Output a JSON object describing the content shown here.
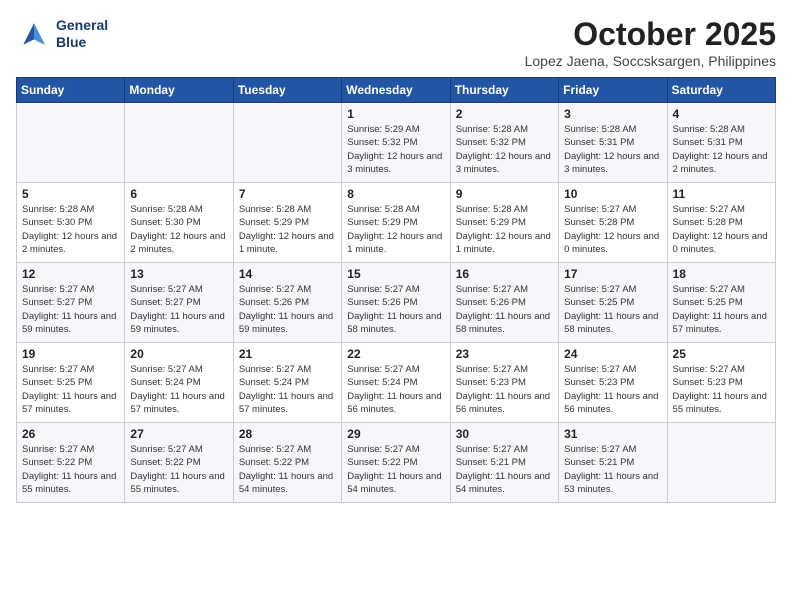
{
  "header": {
    "logo_line1": "General",
    "logo_line2": "Blue",
    "month": "October 2025",
    "location": "Lopez Jaena, Soccsksargen, Philippines"
  },
  "weekdays": [
    "Sunday",
    "Monday",
    "Tuesday",
    "Wednesday",
    "Thursday",
    "Friday",
    "Saturday"
  ],
  "weeks": [
    [
      {
        "day": "",
        "info": ""
      },
      {
        "day": "",
        "info": ""
      },
      {
        "day": "",
        "info": ""
      },
      {
        "day": "1",
        "info": "Sunrise: 5:29 AM\nSunset: 5:32 PM\nDaylight: 12 hours\nand 3 minutes."
      },
      {
        "day": "2",
        "info": "Sunrise: 5:28 AM\nSunset: 5:32 PM\nDaylight: 12 hours\nand 3 minutes."
      },
      {
        "day": "3",
        "info": "Sunrise: 5:28 AM\nSunset: 5:31 PM\nDaylight: 12 hours\nand 3 minutes."
      },
      {
        "day": "4",
        "info": "Sunrise: 5:28 AM\nSunset: 5:31 PM\nDaylight: 12 hours\nand 2 minutes."
      }
    ],
    [
      {
        "day": "5",
        "info": "Sunrise: 5:28 AM\nSunset: 5:30 PM\nDaylight: 12 hours\nand 2 minutes."
      },
      {
        "day": "6",
        "info": "Sunrise: 5:28 AM\nSunset: 5:30 PM\nDaylight: 12 hours\nand 2 minutes."
      },
      {
        "day": "7",
        "info": "Sunrise: 5:28 AM\nSunset: 5:29 PM\nDaylight: 12 hours\nand 1 minute."
      },
      {
        "day": "8",
        "info": "Sunrise: 5:28 AM\nSunset: 5:29 PM\nDaylight: 12 hours\nand 1 minute."
      },
      {
        "day": "9",
        "info": "Sunrise: 5:28 AM\nSunset: 5:29 PM\nDaylight: 12 hours\nand 1 minute."
      },
      {
        "day": "10",
        "info": "Sunrise: 5:27 AM\nSunset: 5:28 PM\nDaylight: 12 hours\nand 0 minutes."
      },
      {
        "day": "11",
        "info": "Sunrise: 5:27 AM\nSunset: 5:28 PM\nDaylight: 12 hours\nand 0 minutes."
      }
    ],
    [
      {
        "day": "12",
        "info": "Sunrise: 5:27 AM\nSunset: 5:27 PM\nDaylight: 11 hours\nand 59 minutes."
      },
      {
        "day": "13",
        "info": "Sunrise: 5:27 AM\nSunset: 5:27 PM\nDaylight: 11 hours\nand 59 minutes."
      },
      {
        "day": "14",
        "info": "Sunrise: 5:27 AM\nSunset: 5:26 PM\nDaylight: 11 hours\nand 59 minutes."
      },
      {
        "day": "15",
        "info": "Sunrise: 5:27 AM\nSunset: 5:26 PM\nDaylight: 11 hours\nand 58 minutes."
      },
      {
        "day": "16",
        "info": "Sunrise: 5:27 AM\nSunset: 5:26 PM\nDaylight: 11 hours\nand 58 minutes."
      },
      {
        "day": "17",
        "info": "Sunrise: 5:27 AM\nSunset: 5:25 PM\nDaylight: 11 hours\nand 58 minutes."
      },
      {
        "day": "18",
        "info": "Sunrise: 5:27 AM\nSunset: 5:25 PM\nDaylight: 11 hours\nand 57 minutes."
      }
    ],
    [
      {
        "day": "19",
        "info": "Sunrise: 5:27 AM\nSunset: 5:25 PM\nDaylight: 11 hours\nand 57 minutes."
      },
      {
        "day": "20",
        "info": "Sunrise: 5:27 AM\nSunset: 5:24 PM\nDaylight: 11 hours\nand 57 minutes."
      },
      {
        "day": "21",
        "info": "Sunrise: 5:27 AM\nSunset: 5:24 PM\nDaylight: 11 hours\nand 57 minutes."
      },
      {
        "day": "22",
        "info": "Sunrise: 5:27 AM\nSunset: 5:24 PM\nDaylight: 11 hours\nand 56 minutes."
      },
      {
        "day": "23",
        "info": "Sunrise: 5:27 AM\nSunset: 5:23 PM\nDaylight: 11 hours\nand 56 minutes."
      },
      {
        "day": "24",
        "info": "Sunrise: 5:27 AM\nSunset: 5:23 PM\nDaylight: 11 hours\nand 56 minutes."
      },
      {
        "day": "25",
        "info": "Sunrise: 5:27 AM\nSunset: 5:23 PM\nDaylight: 11 hours\nand 55 minutes."
      }
    ],
    [
      {
        "day": "26",
        "info": "Sunrise: 5:27 AM\nSunset: 5:22 PM\nDaylight: 11 hours\nand 55 minutes."
      },
      {
        "day": "27",
        "info": "Sunrise: 5:27 AM\nSunset: 5:22 PM\nDaylight: 11 hours\nand 55 minutes."
      },
      {
        "day": "28",
        "info": "Sunrise: 5:27 AM\nSunset: 5:22 PM\nDaylight: 11 hours\nand 54 minutes."
      },
      {
        "day": "29",
        "info": "Sunrise: 5:27 AM\nSunset: 5:22 PM\nDaylight: 11 hours\nand 54 minutes."
      },
      {
        "day": "30",
        "info": "Sunrise: 5:27 AM\nSunset: 5:21 PM\nDaylight: 11 hours\nand 54 minutes."
      },
      {
        "day": "31",
        "info": "Sunrise: 5:27 AM\nSunset: 5:21 PM\nDaylight: 11 hours\nand 53 minutes."
      },
      {
        "day": "",
        "info": ""
      }
    ]
  ]
}
